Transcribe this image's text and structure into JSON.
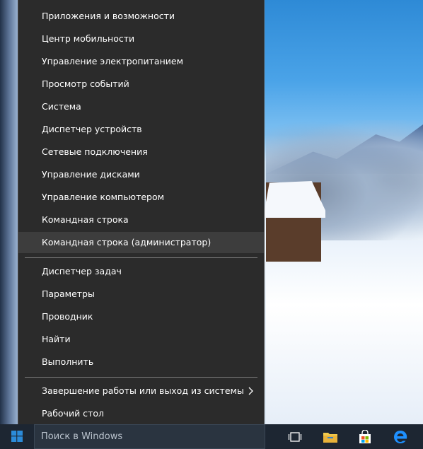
{
  "menu": {
    "items": [
      {
        "label": "Приложения и возможности"
      },
      {
        "label": "Центр мобильности"
      },
      {
        "label": "Управление электропитанием"
      },
      {
        "label": "Просмотр событий"
      },
      {
        "label": "Система"
      },
      {
        "label": "Диспетчер устройств"
      },
      {
        "label": "Сетевые подключения"
      },
      {
        "label": "Управление дисками"
      },
      {
        "label": "Управление компьютером"
      },
      {
        "label": "Командная строка"
      },
      {
        "label": "Командная строка (администратор)"
      },
      {
        "label": "Диспетчер задач"
      },
      {
        "label": "Параметры"
      },
      {
        "label": "Проводник"
      },
      {
        "label": "Найти"
      },
      {
        "label": "Выполнить"
      },
      {
        "label": "Завершение работы или выход из системы"
      },
      {
        "label": "Рабочий стол"
      }
    ],
    "highlighted_item": "Командная строка (администратор)",
    "submenu_chevron_icon": "chevron-right-icon"
  },
  "taskbar": {
    "start_icon": "windows-logo-icon",
    "search_placeholder": "Поиск в Windows",
    "pinned": [
      {
        "icon": "task-view-icon"
      },
      {
        "icon": "file-explorer-icon"
      },
      {
        "icon": "store-icon"
      },
      {
        "icon": "edge-icon"
      }
    ]
  },
  "colors": {
    "menu_bg": "#2b2b2b",
    "menu_highlight": "#3d3d3d",
    "taskbar_bg": "#1d2632",
    "accent_blue": "#0078d7"
  }
}
